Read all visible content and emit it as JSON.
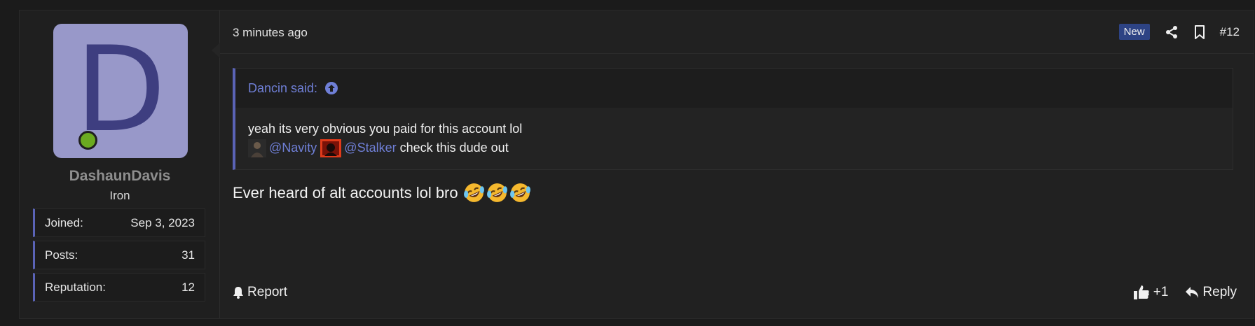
{
  "user": {
    "avatar_letter": "D",
    "avatar_bg": "#9898c9",
    "avatar_fg": "#3e3e80",
    "online_status": "online",
    "name": "DashaunDavis",
    "title": "Iron",
    "stats": [
      {
        "label": "Joined:",
        "value": "Sep 3, 2023"
      },
      {
        "label": "Posts:",
        "value": "31"
      },
      {
        "label": "Reputation:",
        "value": "12"
      }
    ]
  },
  "post": {
    "timestamp": "3 minutes ago",
    "badge": "New",
    "number": "#12",
    "quote": {
      "author_line": "Dancin said:",
      "line1": "yeah its very obvious you paid for this account lol",
      "mentions": [
        "@Navity",
        "@Stalker"
      ],
      "line2_suffix": "check this dude out"
    },
    "message": "Ever heard of alt accounts lol bro",
    "emoji": [
      "rolling-on-floor-laughing",
      "rolling-on-floor-laughing",
      "rolling-on-floor-laughing"
    ]
  },
  "footer": {
    "report_label": "Report",
    "like_count": "+1",
    "reply_label": "Reply"
  },
  "colors": {
    "accent": "#5a63b6",
    "link": "#6f7fd6",
    "badge_bg": "#2d4384",
    "online": "#6bab20"
  },
  "icons": [
    "share-icon",
    "bookmark-icon",
    "arrow-up-circle-icon",
    "bell-icon",
    "thumbs-up-icon",
    "reply-icon"
  ]
}
